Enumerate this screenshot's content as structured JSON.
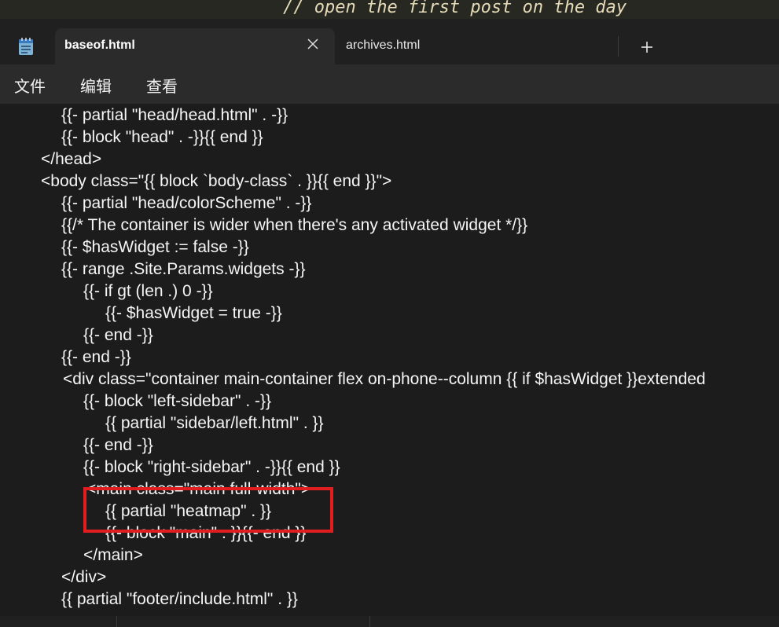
{
  "background_window": {
    "code_line": "// open the first post on the day"
  },
  "tabs": [
    {
      "label": "baseof.html",
      "active": true
    },
    {
      "label": "archives.html",
      "active": false
    }
  ],
  "new_tab_label": "+",
  "menu": [
    "文件",
    "编辑",
    "查看"
  ],
  "code_lines": [
    "{{- partial \"head/head.html\" . -}}",
    "{{- block \"head\" . -}}{{ end }}",
    "</head>",
    "<body class=\"{{ block `body-class` . }}{{ end }}\">",
    "{{- partial \"head/colorScheme\" . -}}",
    "{{/* The container is wider when there's any activated widget */}}",
    "{{- $hasWidget := false -}}",
    "{{- range .Site.Params.widgets -}}",
    "{{- if gt (len .) 0 -}}",
    "{{- $hasWidget = true -}}",
    "{{- end -}}",
    "{{- end -}}",
    "<div class=\"container main-container flex on-phone--column {{ if $hasWidget }}extended",
    "{{- block \"left-sidebar\" . -}}",
    "{{ partial \"sidebar/left.html\" . }}",
    "{{- end -}}",
    "{{- block \"right-sidebar\" . -}}{{ end }}",
    "<main class=\"main full-width\">",
    "{{ partial \"heatmap\" . }}",
    "{{- block \"main\" . }}{{- end }}",
    "</main>",
    "</div>",
    "{{ partial \"footer/include.html\" . }}"
  ],
  "highlight_color": "#e11d20",
  "colors": {
    "editor_bg": "#1c1c1c",
    "text": "#f5f5f5",
    "tab_active_bg": "#2b2b2b"
  }
}
